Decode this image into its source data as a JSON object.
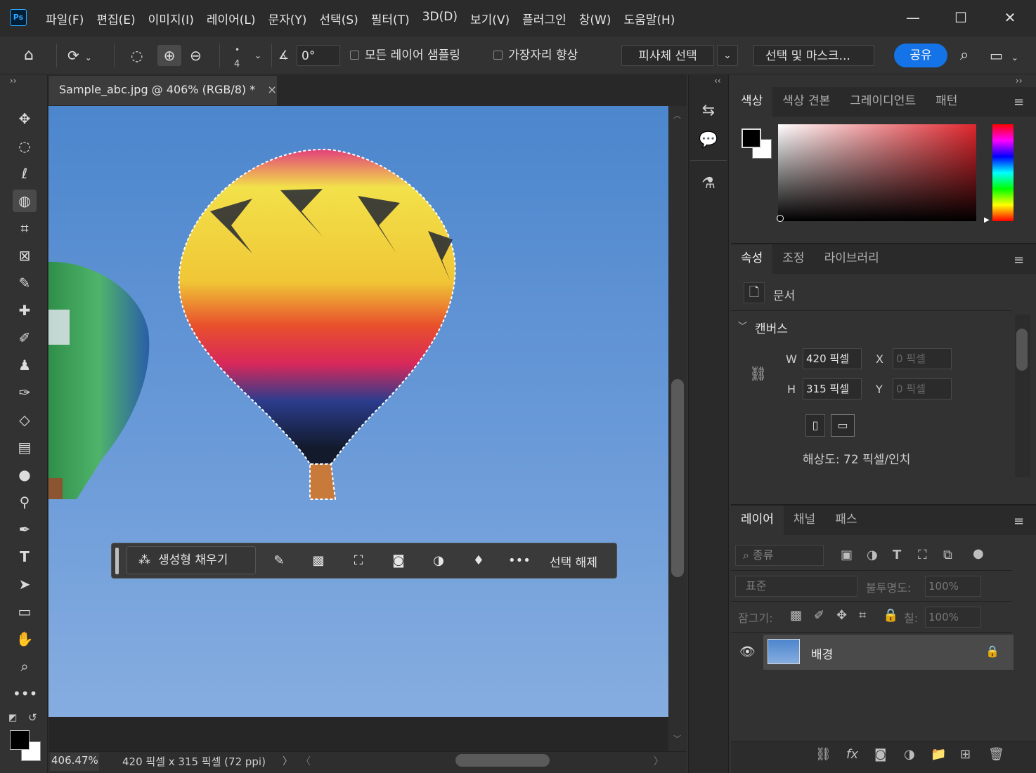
{
  "app": {
    "logo": "Ps"
  },
  "menu": [
    "파일(F)",
    "편집(E)",
    "이미지(I)",
    "레이어(L)",
    "문자(Y)",
    "선택(S)",
    "필터(T)",
    "3D(D)",
    "보기(V)",
    "플러그인",
    "창(W)",
    "도움말(H)"
  ],
  "window_controls": {
    "minimize": "—",
    "maximize": "☐",
    "close": "✕"
  },
  "options": {
    "brush_size": "4",
    "angle_value": "0°",
    "sample_all_layers": "모든 레이어 샘플링",
    "enhance_edge": "가장자리 향상",
    "select_subject": "피사체 선택",
    "select_and_mask": "선택 및 마스크...",
    "share": "공유"
  },
  "document": {
    "tab_title": "Sample_abc.jpg @ 406% (RGB/8) *",
    "close": "×",
    "zoom": "406.47%",
    "info": "420 픽셀 x 315 픽셀 (72 ppi)"
  },
  "contextual_bar": {
    "generative_fill": "생성형 채우기",
    "deselect": "선택 해제"
  },
  "color_panel": {
    "tabs": [
      "색상",
      "색상 견본",
      "그레이디언트",
      "패턴"
    ],
    "foreground": "#000000",
    "background": "#ffffff",
    "hue_color": "#e0262d"
  },
  "properties_panel": {
    "tabs": [
      "속성",
      "조정",
      "라이브러리"
    ],
    "doc_label": "문서",
    "canvas_section": "캔버스",
    "w_label": "W",
    "w_value": "420 픽셀",
    "h_label": "H",
    "h_value": "315 픽셀",
    "x_label": "X",
    "x_value": "0 픽셀",
    "y_label": "Y",
    "y_value": "0 픽셀",
    "resolution": "해상도: 72 픽셀/인치"
  },
  "layers_panel": {
    "tabs": [
      "레이어",
      "채널",
      "패스"
    ],
    "filter_kind": "종류",
    "blend_mode": "표준",
    "opacity_label": "불투명도:",
    "opacity_value": "100%",
    "lock_label": "잠그기:",
    "fill_label": "칠:",
    "fill_value": "100%",
    "layer_name": "배경"
  }
}
